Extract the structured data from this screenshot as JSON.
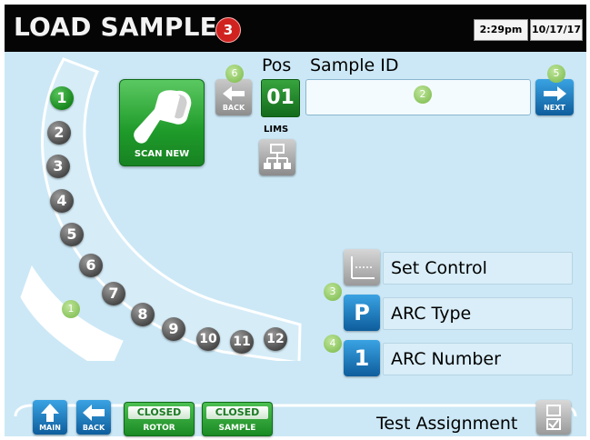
{
  "header": {
    "title": "LOAD SAMPLE",
    "step_badge": "3",
    "time": "2:29pm",
    "date": "10/17/17"
  },
  "rotor": {
    "slots": [
      "1",
      "2",
      "3",
      "4",
      "5",
      "6",
      "7",
      "8",
      "9",
      "10",
      "11",
      "12"
    ],
    "active_slot": "1",
    "hint_badge": "1"
  },
  "scan": {
    "label": "SCAN NEW"
  },
  "sample_entry": {
    "back_label": "BACK",
    "back_hint": "6",
    "pos_label": "Pos",
    "pos_value": "01",
    "sample_id_label": "Sample ID",
    "sample_id_value": "",
    "sample_id_hint": "2",
    "next_label": "NEXT",
    "next_hint": "5",
    "lims_label": "LIMS"
  },
  "controls": {
    "set_control_label": "Set Control",
    "arc_type_label": "ARC Type",
    "arc_type_value": "P",
    "arc_type_hint": "3",
    "arc_number_label": "ARC Number",
    "arc_number_value": "1",
    "arc_number_hint": "4"
  },
  "bottom": {
    "main_label": "MAIN",
    "back_label": "BACK",
    "rotor_status": "CLOSED",
    "rotor_label": "ROTOR",
    "sample_status": "CLOSED",
    "sample_label": "SAMPLE",
    "test_assignment_label": "Test Assignment"
  },
  "colors": {
    "screen_bg": "#cce8f6",
    "header_bg": "#050505",
    "accent_green": "#1f9b2a",
    "accent_blue": "#0e6fb5",
    "badge_red": "#d0231f"
  }
}
